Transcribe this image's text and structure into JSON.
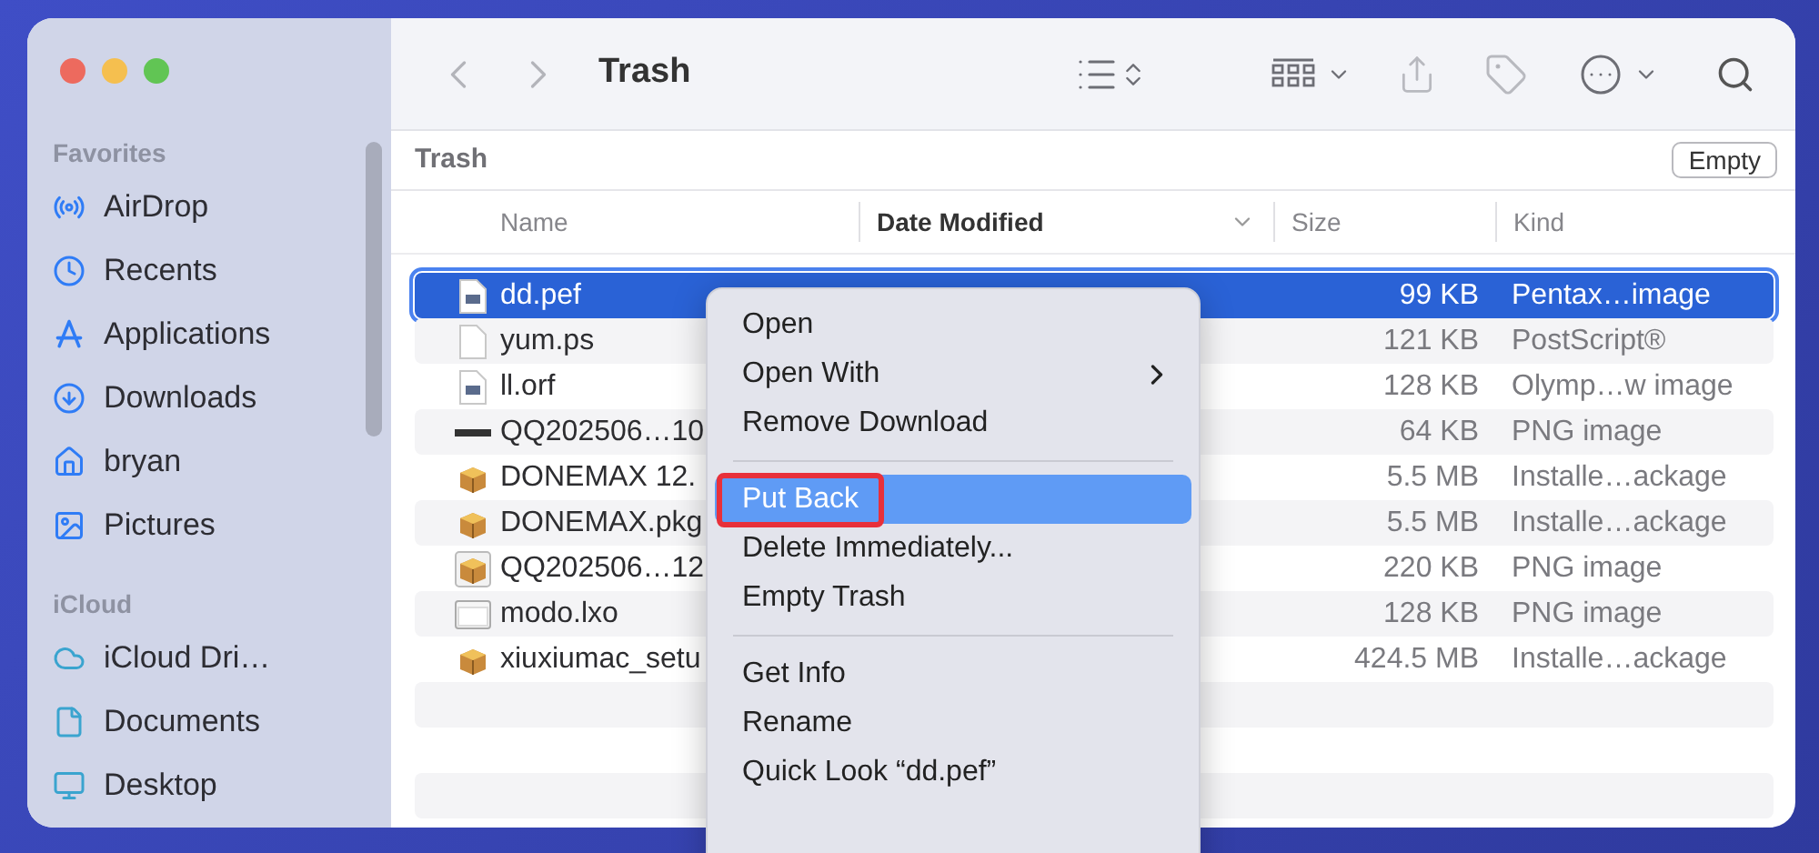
{
  "window": {
    "title": "Trash"
  },
  "sidebar": {
    "sections": [
      {
        "header": "Favorites",
        "items": [
          {
            "label": "AirDrop"
          },
          {
            "label": "Recents"
          },
          {
            "label": "Applications"
          },
          {
            "label": "Downloads"
          },
          {
            "label": "bryan"
          },
          {
            "label": "Pictures"
          }
        ]
      },
      {
        "header": "iCloud",
        "items": [
          {
            "label": "iCloud Dri…"
          },
          {
            "label": "Documents"
          },
          {
            "label": "Desktop"
          }
        ]
      }
    ]
  },
  "path_bar": {
    "title": "Trash",
    "button": "Empty"
  },
  "table": {
    "columns": [
      {
        "label": "Name",
        "sorted": false
      },
      {
        "label": "Date Modified",
        "sorted": true
      },
      {
        "label": "Size",
        "sorted": false
      },
      {
        "label": "Kind",
        "sorted": false
      }
    ],
    "rows": [
      {
        "name": "dd.pef",
        "size": "99 KB",
        "kind": "Pentax…image",
        "selected": true
      },
      {
        "name": "yum.ps",
        "size": "121 KB",
        "kind": "PostScript®",
        "selected": false
      },
      {
        "name": "ll.orf",
        "size": "128 KB",
        "kind": "Olymp…w image",
        "selected": false
      },
      {
        "name": "QQ202506…10",
        "size": "64 KB",
        "kind": "PNG image",
        "selected": false
      },
      {
        "name": "DONEMAX 12.",
        "size": "5.5 MB",
        "kind": "Installe…ackage",
        "selected": false
      },
      {
        "name": "DONEMAX.pkg",
        "size": "5.5 MB",
        "kind": "Installe…ackage",
        "selected": false
      },
      {
        "name": "QQ202506…12",
        "size": "220 KB",
        "kind": "PNG image",
        "selected": false
      },
      {
        "name": "modo.lxo",
        "size": "128 KB",
        "kind": "PNG image",
        "selected": false
      },
      {
        "name": "xiuxiumac_setu",
        "size": "424.5 MB",
        "kind": "Installe…ackage",
        "selected": false
      }
    ]
  },
  "context_menu": {
    "groups": [
      [
        {
          "label": "Open",
          "submenu": false,
          "selected": false,
          "outlined": false
        },
        {
          "label": "Open With",
          "submenu": true,
          "selected": false,
          "outlined": false
        },
        {
          "label": "Remove Download",
          "submenu": false,
          "selected": false,
          "outlined": false
        }
      ],
      [
        {
          "label": "Put Back",
          "submenu": false,
          "selected": true,
          "outlined": true
        },
        {
          "label": "Delete Immediately...",
          "submenu": false,
          "selected": false,
          "outlined": false
        },
        {
          "label": "Empty Trash",
          "submenu": false,
          "selected": false,
          "outlined": false
        }
      ],
      [
        {
          "label": "Get Info",
          "submenu": false,
          "selected": false,
          "outlined": false
        },
        {
          "label": "Rename",
          "submenu": false,
          "selected": false,
          "outlined": false
        },
        {
          "label": "Quick Look “dd.pef”",
          "submenu": false,
          "selected": false,
          "outlined": false
        }
      ]
    ]
  }
}
